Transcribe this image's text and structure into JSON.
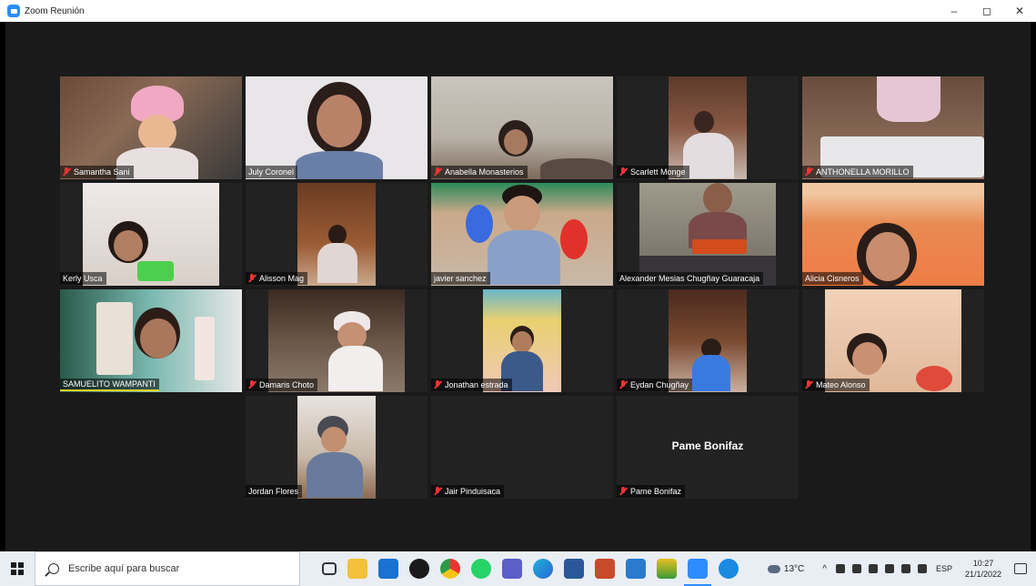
{
  "window": {
    "title": "Zoom Reunión",
    "minimize": "–",
    "restore": "◻",
    "close": "✕"
  },
  "participants": [
    {
      "name": "Samantha Sani",
      "muted": true
    },
    {
      "name": "July Coronel",
      "muted": false
    },
    {
      "name": "Anabella  Monasterios",
      "muted": true
    },
    {
      "name": "Scarlett Monge",
      "muted": true
    },
    {
      "name": "ANTHONELLA MORILLO",
      "muted": true
    },
    {
      "name": "Kerly Usca",
      "muted": false
    },
    {
      "name": "Alisson Mag",
      "muted": true
    },
    {
      "name": "javier sanchez",
      "muted": false
    },
    {
      "name": "Alexander Mesias Chugñay Guaracaja",
      "muted": false
    },
    {
      "name": "Alicia Cisneros",
      "muted": false,
      "active_speaker": true
    },
    {
      "name": "SAMUELITO WAMPANTI",
      "muted": false
    },
    {
      "name": "Damaris Choto",
      "muted": true
    },
    {
      "name": "Jonathan estrada",
      "muted": true
    },
    {
      "name": "Eydan Chugñay",
      "muted": true
    },
    {
      "name": "Mateo Alonso",
      "muted": true
    },
    {
      "name": "Jordan Flores",
      "muted": false
    },
    {
      "name": "Jair Pinduisaca",
      "muted": true
    },
    {
      "name": "Pame Bonifaz",
      "muted": true,
      "video_off": true
    }
  ],
  "taskbar": {
    "search_placeholder": "Escribe aquí para buscar",
    "apps": [
      "task-view-icon",
      "file-explorer-icon",
      "mail-icon",
      "github-icon",
      "chrome-icon",
      "whatsapp-icon",
      "teams-icon",
      "edge-icon",
      "word-icon",
      "app-icon",
      "notepad-icon",
      "stack-icon",
      "zoom-icon",
      "chat-icon"
    ],
    "weather": "13°C",
    "caret": "^",
    "language": "ESP",
    "time": "10:27",
    "date": "21/1/2022"
  },
  "colors": {
    "active_speaker_border": "#c6e24a",
    "muted_icon": "#e33333",
    "meeting_bg": "#1a1a1a"
  }
}
